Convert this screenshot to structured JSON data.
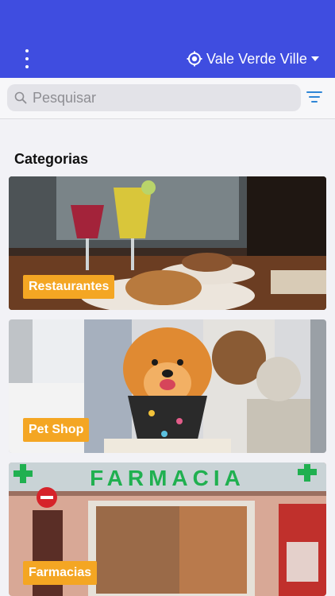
{
  "header": {
    "location": "Vale Verde Ville",
    "background_color": "#3f4de0"
  },
  "search": {
    "placeholder": "Pesquisar"
  },
  "section": {
    "title": "Categorias"
  },
  "categories": [
    {
      "label": "Restaurantes",
      "image": "restaurant-photo"
    },
    {
      "label": "Pet Shop",
      "image": "pet-shop-photo"
    },
    {
      "label": "Farmacias",
      "image": "pharmacy-photo",
      "sign_text": "FARMACIA"
    }
  ],
  "accent_label_color": "#f4a623"
}
